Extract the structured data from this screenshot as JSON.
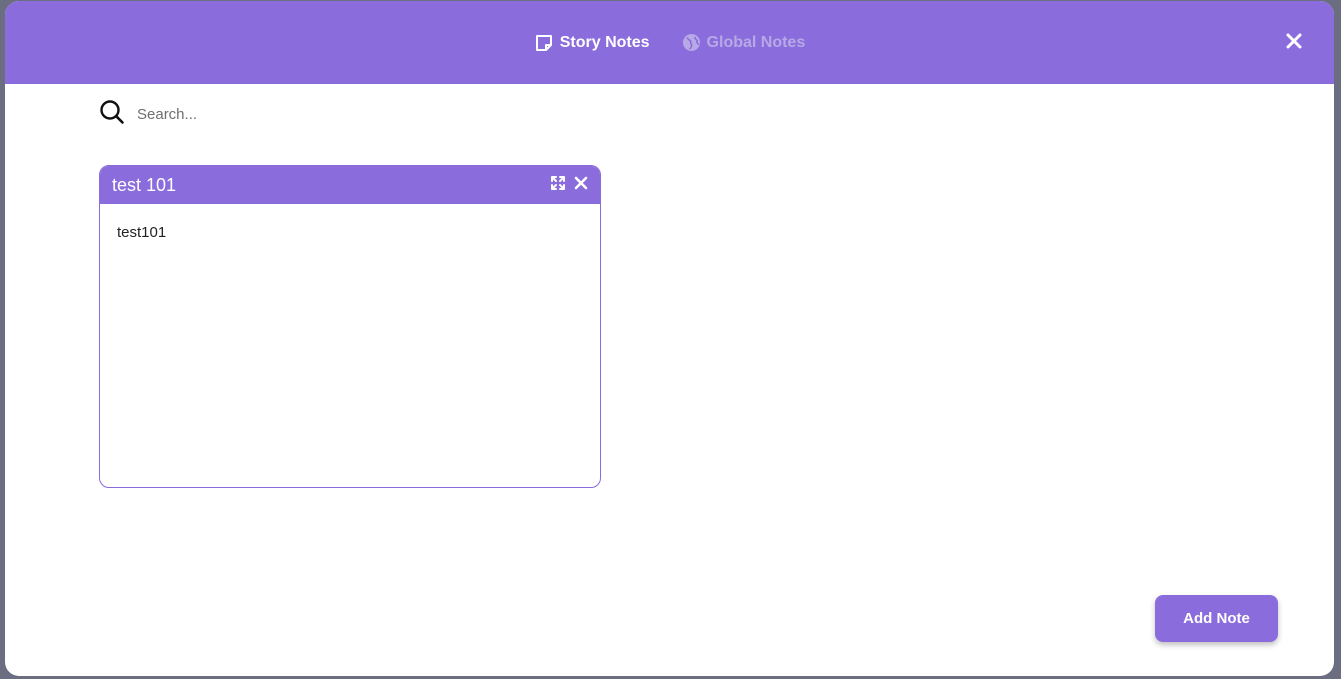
{
  "tabs": [
    {
      "label": "Story Notes",
      "icon": "sticky-note-icon",
      "active": true
    },
    {
      "label": "Global Notes",
      "icon": "globe-icon",
      "active": false
    }
  ],
  "search": {
    "placeholder": "Search...",
    "value": ""
  },
  "notes": [
    {
      "title": "test 101",
      "body": "test101"
    }
  ],
  "add_note_label": "Add Note",
  "colors": {
    "accent": "#8b6cdc",
    "inactive_tab": "#b7a8e6"
  }
}
